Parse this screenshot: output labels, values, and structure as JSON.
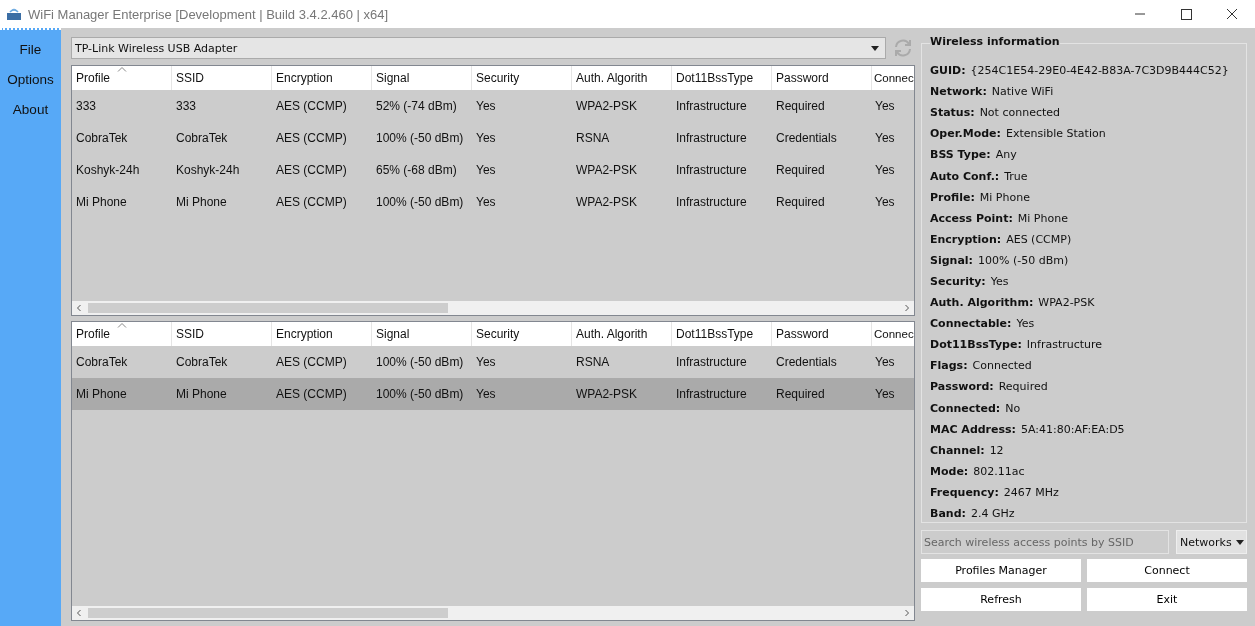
{
  "window": {
    "title": "WiFi Manager Enterprise [Development | Build 3.4.2.460 | x64]"
  },
  "sidebar": {
    "items": [
      {
        "label": "File"
      },
      {
        "label": "Options"
      },
      {
        "label": "About"
      }
    ]
  },
  "adapter": {
    "value": "TP-Link Wireless USB Adapter"
  },
  "tables": [
    {
      "columns": [
        "Profile",
        "SSID",
        "Encryption",
        "Signal",
        "Security",
        "Auth. Algorith",
        "Dot11BssType",
        "Password",
        "Connec"
      ],
      "rows": [
        {
          "selected": false,
          "cells": [
            "333",
            "333",
            "AES (CCMP)",
            "52% (-74 dBm)",
            "Yes",
            "WPA2-PSK",
            "Infrastructure",
            "Required",
            "Yes"
          ]
        },
        {
          "selected": false,
          "cells": [
            "CobraTek",
            "CobraTek",
            "AES (CCMP)",
            "100% (-50 dBm)",
            "Yes",
            "RSNA",
            "Infrastructure",
            "Credentials",
            "Yes"
          ]
        },
        {
          "selected": false,
          "cells": [
            "Koshyk-24h",
            "Koshyk-24h",
            "AES (CCMP)",
            "65% (-68 dBm)",
            "Yes",
            "WPA2-PSK",
            "Infrastructure",
            "Required",
            "Yes"
          ]
        },
        {
          "selected": false,
          "cells": [
            "Mi Phone",
            "Mi Phone",
            "AES (CCMP)",
            "100% (-50 dBm)",
            "Yes",
            "WPA2-PSK",
            "Infrastructure",
            "Required",
            "Yes"
          ]
        }
      ]
    },
    {
      "columns": [
        "Profile",
        "SSID",
        "Encryption",
        "Signal",
        "Security",
        "Auth. Algorith",
        "Dot11BssType",
        "Password",
        "Connec"
      ],
      "rows": [
        {
          "selected": false,
          "cells": [
            "CobraTek",
            "CobraTek",
            "AES (CCMP)",
            "100% (-50 dBm)",
            "Yes",
            "RSNA",
            "Infrastructure",
            "Credentials",
            "Yes"
          ]
        },
        {
          "selected": true,
          "cells": [
            "Mi Phone",
            "Mi Phone",
            "AES (CCMP)",
            "100% (-50 dBm)",
            "Yes",
            "WPA2-PSK",
            "Infrastructure",
            "Required",
            "Yes"
          ]
        }
      ]
    }
  ],
  "info": {
    "title": "Wireless information",
    "items": [
      {
        "label": "GUID:",
        "value": "{254C1E54-29E0-4E42-B83A-7C3D9B444C52}"
      },
      {
        "label": "Network:",
        "value": "Native WiFi"
      },
      {
        "label": "Status:",
        "value": "Not connected"
      },
      {
        "label": "Oper.Mode:",
        "value": "Extensible Station"
      },
      {
        "label": "BSS Type:",
        "value": "Any"
      },
      {
        "label": "Auto Conf.:",
        "value": "True"
      },
      {
        "label": "Profile:",
        "value": "Mi Phone"
      },
      {
        "label": "Access Point:",
        "value": "Mi Phone"
      },
      {
        "label": "Encryption:",
        "value": "AES (CCMP)"
      },
      {
        "label": "Signal:",
        "value": "100% (-50 dBm)"
      },
      {
        "label": "Security:",
        "value": "Yes"
      },
      {
        "label": "Auth. Algorithm:",
        "value": "WPA2-PSK"
      },
      {
        "label": "Connectable:",
        "value": "Yes"
      },
      {
        "label": "Dot11BssType:",
        "value": "Infrastructure"
      },
      {
        "label": "Flags:",
        "value": "Connected"
      },
      {
        "label": "Password:",
        "value": "Required"
      },
      {
        "label": "Connected:",
        "value": "No"
      },
      {
        "label": "MAC Address:",
        "value": "5A:41:80:AF:EA:D5"
      },
      {
        "label": "Channel:",
        "value": "12"
      },
      {
        "label": "Mode:",
        "value": "802.11ac"
      },
      {
        "label": "Frequency:",
        "value": "2467 MHz"
      },
      {
        "label": "Band:",
        "value": "2.4 GHz"
      }
    ]
  },
  "search": {
    "placeholder": "Search wireless access points by SSID"
  },
  "filter": {
    "value": "Networks"
  },
  "buttons": [
    "Profiles Manager",
    "Connect",
    "Refresh",
    "Exit"
  ]
}
